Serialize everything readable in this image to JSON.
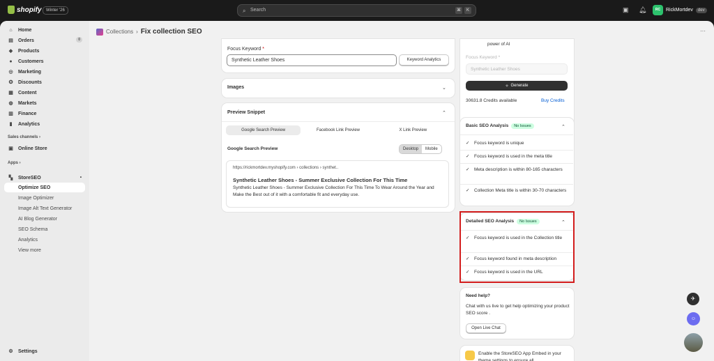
{
  "topbar": {
    "brand": "shopify",
    "edition": "Winter '26",
    "search_placeholder": "Search",
    "kbd_1": "⌘",
    "kbd_2": "K",
    "user_initials": "RC",
    "user_name": "RickMortdev",
    "user_badge": "dev"
  },
  "sidebar": {
    "items": [
      {
        "label": "Home",
        "icon": "home-icon"
      },
      {
        "label": "Orders",
        "icon": "orders-icon",
        "count": "0"
      },
      {
        "label": "Products",
        "icon": "tag-icon"
      },
      {
        "label": "Customers",
        "icon": "person-icon"
      },
      {
        "label": "Marketing",
        "icon": "target-icon"
      },
      {
        "label": "Discounts",
        "icon": "discount-icon"
      },
      {
        "label": "Content",
        "icon": "content-icon"
      },
      {
        "label": "Markets",
        "icon": "globe-icon"
      },
      {
        "label": "Finance",
        "icon": "bank-icon"
      },
      {
        "label": "Analytics",
        "icon": "chart-icon"
      }
    ],
    "sales_channels": "Sales channels",
    "online_store": "Online Store",
    "apps": "Apps",
    "app_name": "StoreSEO",
    "sub_items": [
      "Optimize SEO",
      "Image Optimizer",
      "Image Alt Text Generator",
      "AI Blog Generator",
      "SEO Schema",
      "Analytics",
      "View more"
    ],
    "settings": "Settings"
  },
  "breadcrumb": {
    "parent": "Collections",
    "separator": "›",
    "title": "Fix collection SEO"
  },
  "focus": {
    "label": "Focus Keyword",
    "required": "*",
    "value": "Synthetic Leather Shoes",
    "button": "Keyword Analytics"
  },
  "images": {
    "title": "Images"
  },
  "preview": {
    "title": "Preview Snippet",
    "tabs": [
      "Google Search Preview",
      "Facebook Link Preview",
      "X Link Preview"
    ],
    "subtitle": "Google Search Preview",
    "device_desktop": "Desktop",
    "device_mobile": "Mobile",
    "url": "https://rickmortdev.myshopify.com  ›  collections  ›  synthet..",
    "snippet_title": "Synthetic Leather Shoes - Summer Exclusive Collection For This Time",
    "snippet_desc": "Synthetic Leather Shoes - Summer Exclusive Collection For This Time To Wear Around the Year and Make the Best out of it with a comfortable fit and everyday use."
  },
  "ai": {
    "top_text": "power of AI",
    "label": "Focus Keyword",
    "required": "*",
    "placeholder": "Synthetic Leather Shoes",
    "button": "Generate",
    "credits": "30631.8 Credits available",
    "buy": "Buy Credits"
  },
  "basic": {
    "title": "Basic SEO Analysis",
    "badge": "No Issues",
    "checks": [
      "Focus keyword is unique",
      "Focus keyword is used in the meta title",
      "Meta description is within 80-165 characters",
      "Collection Meta title is within 30-70 characters"
    ]
  },
  "detailed": {
    "title": "Detailed SEO Analysis",
    "badge": "No Issues",
    "checks": [
      "Focus keyword is used in the Collection title",
      "Focus keyword found in meta description",
      "Focus keyword is used in the URL"
    ]
  },
  "help": {
    "title": "Need help?",
    "text": "Chat with us live to get help optimizing your product SEO score .",
    "button": "Open Live Chat"
  },
  "embed": {
    "text": "Enable the StoreSEO App Embed in your theme settings to ensure all"
  },
  "colors": {
    "highlight": "#d31d1d",
    "badge_bg": "#cdfee1",
    "link": "#005bd3"
  }
}
